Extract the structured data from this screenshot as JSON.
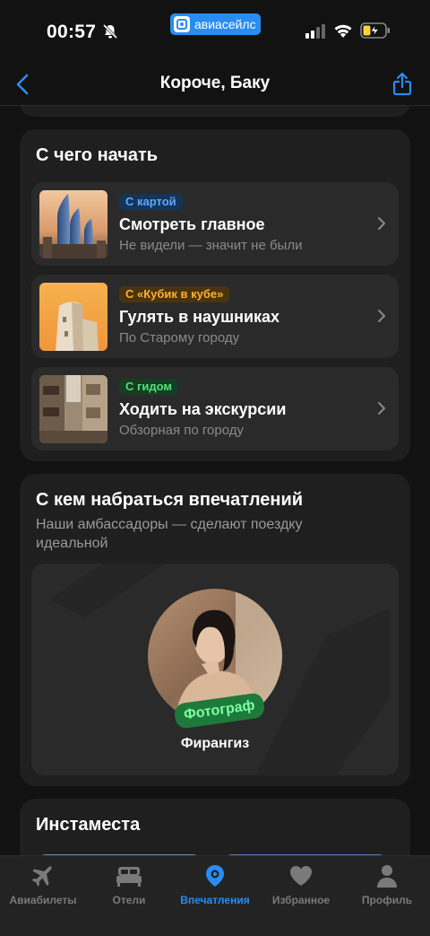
{
  "status_bar": {
    "time": "00:57",
    "app_pill": "авиасейлс"
  },
  "nav": {
    "title": "Короче, Баку"
  },
  "start_section": {
    "title": "С чего начать",
    "items": [
      {
        "badge": "С картой",
        "badge_color": "#5aa9ff",
        "badge_bg": "#153457",
        "title": "Смотреть главное",
        "subtitle": "Не видели — значит не были"
      },
      {
        "badge": "С «Кубик в кубе»",
        "badge_color": "#ffb02e",
        "badge_bg": "#4a3410",
        "title": "Гулять в наушниках",
        "subtitle": "По Старому городу"
      },
      {
        "badge": "С гидом",
        "badge_color": "#4fe07a",
        "badge_bg": "#173d22",
        "title": "Ходить на экскурсии",
        "subtitle": "Обзорная по городу"
      }
    ]
  },
  "ambassadors_section": {
    "title": "С кем набраться впечатлений",
    "subtitle": "Наши амбассадоры — сделают поездку идеальной",
    "ambassador": {
      "tag": "Фотограф",
      "name": "Фирангиз"
    }
  },
  "insta_section": {
    "title": "Инстаместа"
  },
  "tab_bar": {
    "active_color": "#2a8cf0",
    "tabs": [
      {
        "label": "Авиабилеты",
        "icon": "plane-icon"
      },
      {
        "label": "Отели",
        "icon": "bed-icon"
      },
      {
        "label": "Впечатления",
        "icon": "location-icon",
        "active": true
      },
      {
        "label": "Избранное",
        "icon": "heart-icon"
      },
      {
        "label": "Профиль",
        "icon": "person-icon"
      }
    ]
  }
}
